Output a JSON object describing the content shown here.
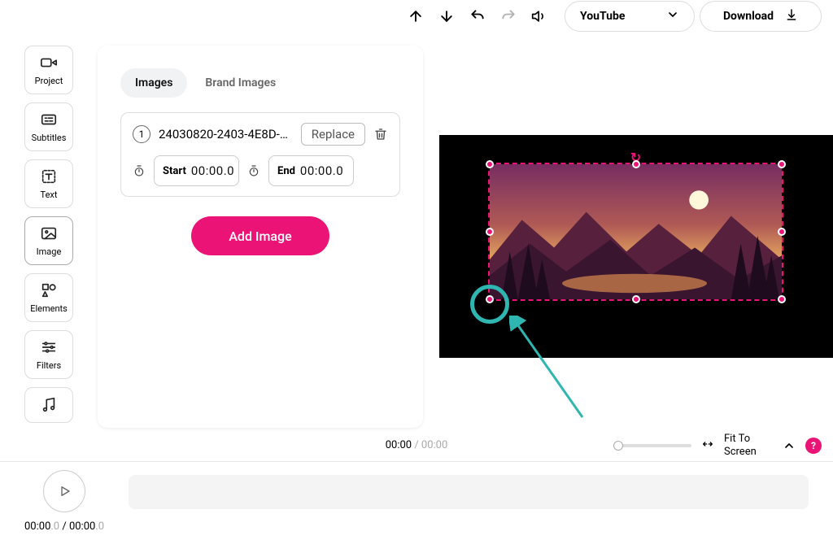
{
  "header": {
    "export_preset": "YouTube",
    "download_label": "Download"
  },
  "sidebar": {
    "items": [
      {
        "label": "Project"
      },
      {
        "label": "Subtitles"
      },
      {
        "label": "Text"
      },
      {
        "label": "Image"
      },
      {
        "label": "Elements"
      },
      {
        "label": "Filters"
      },
      {
        "label": ""
      }
    ],
    "active_index": 3
  },
  "panel": {
    "tabs": [
      {
        "label": "Images"
      },
      {
        "label": "Brand Images"
      }
    ],
    "active_tab": 0,
    "image_item": {
      "index": "1",
      "filename": "24030820-2403-4E8D-…",
      "replace_label": "Replace",
      "start_label": "Start",
      "start_value": "00:00.0",
      "end_label": "End",
      "end_value": "00:00.0"
    },
    "add_image_label": "Add Image"
  },
  "timeline": {
    "current": "00:00",
    "total": "00:00",
    "fit_label": "Fit To Screen",
    "help_label": "?"
  },
  "footer": {
    "current": "00:00",
    "current_dec": ".0",
    "sep": " / ",
    "total": "00:00",
    "total_dec": ".0"
  },
  "colors": {
    "accent": "#ec1377",
    "teal": "#2fb6b0"
  }
}
